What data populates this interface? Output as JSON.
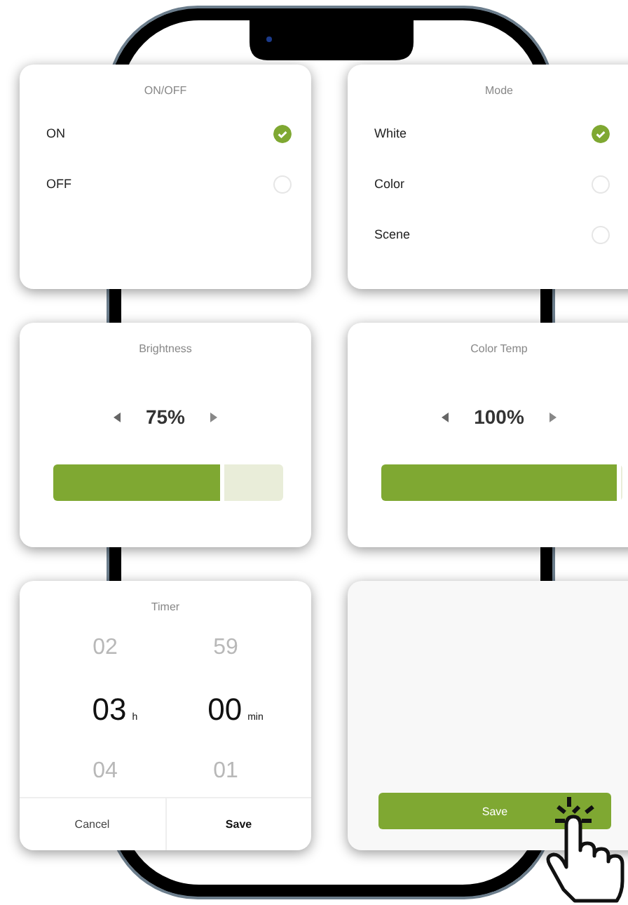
{
  "onoff": {
    "title": "ON/OFF",
    "options": [
      {
        "label": "ON",
        "selected": true
      },
      {
        "label": "OFF",
        "selected": false
      }
    ]
  },
  "mode": {
    "title": "Mode",
    "options": [
      {
        "label": "White",
        "selected": true
      },
      {
        "label": "Color",
        "selected": false
      },
      {
        "label": "Scene",
        "selected": false
      }
    ]
  },
  "brightness": {
    "title": "Brightness",
    "value": "75%",
    "level": 0.75
  },
  "color_temp": {
    "title": "Color Temp",
    "value": "100%",
    "level": 1.0
  },
  "timer": {
    "title": "Timer",
    "hours": [
      "02",
      "03",
      "04"
    ],
    "hours_unit": "h",
    "minutes": [
      "59",
      "00",
      "01"
    ],
    "minutes_unit": "min",
    "buttons": [
      "Cancel",
      "Save"
    ]
  },
  "save_card": {
    "button": "Save"
  }
}
